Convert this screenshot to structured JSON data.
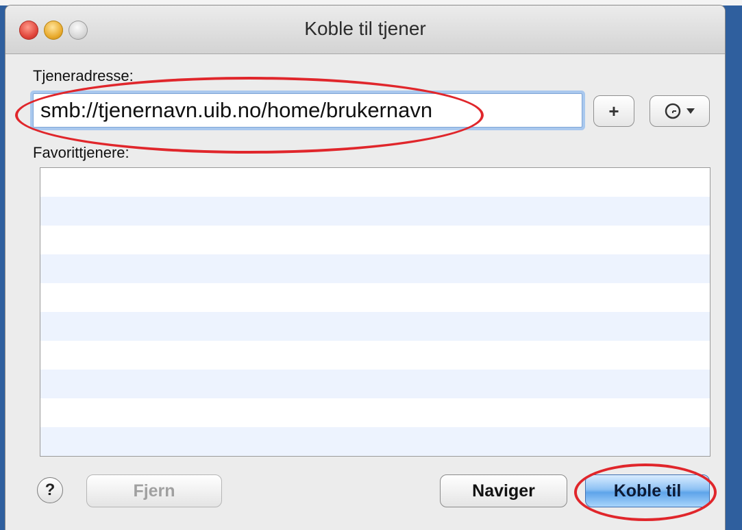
{
  "window": {
    "title": "Koble til tjener"
  },
  "address": {
    "label": "Tjeneradresse:",
    "value": "smb://tjenernavn.uib.no/home/brukernavn",
    "add_button": "+"
  },
  "favorites": {
    "label": "Favorittjenere:",
    "rows": 10
  },
  "buttons": {
    "help": "?",
    "remove": "Fjern",
    "browse": "Naviger",
    "connect": "Koble til"
  },
  "colors": {
    "highlight": "#e0262b",
    "default_button": "#5ea4ea",
    "desktop": "#2f5f9e"
  },
  "icons": {
    "recent": "clock-icon",
    "dropdown": "chevron-down-icon"
  }
}
